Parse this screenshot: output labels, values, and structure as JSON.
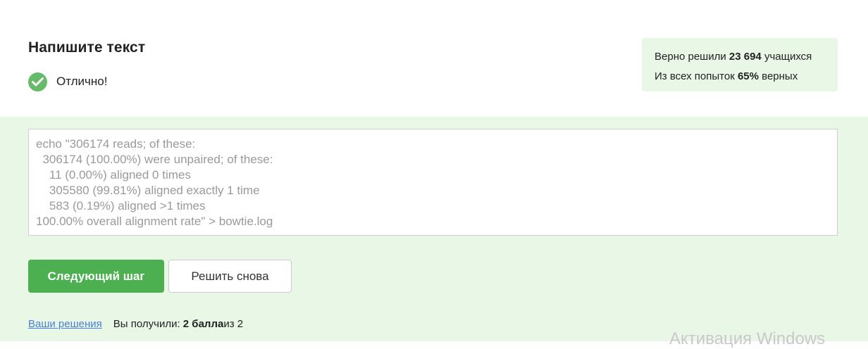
{
  "task": {
    "title": "Напишите текст",
    "status": "Отлично!"
  },
  "stats": {
    "line1_prefix": "Верно решили ",
    "solved_count": "23 694",
    "line1_suffix": " учащихся",
    "line2_prefix": "Из всех попыток ",
    "correct_percent": "65%",
    "line2_suffix": " верных"
  },
  "answer": {
    "text": "echo \"306174 reads; of these:\n  306174 (100.00%) were unpaired; of these:\n    11 (0.00%) aligned 0 times\n    305580 (99.81%) aligned exactly 1 time\n    583 (0.19%) aligned >1 times\n100.00% overall alignment rate\" > bowtie.log"
  },
  "buttons": {
    "next": "Следующий шаг",
    "retry": "Решить снова"
  },
  "footer": {
    "solutions_link": "Ваши решения",
    "score_prefix": "Вы получили: ",
    "score_value": "2 балла",
    "score_suffix": " из 2"
  },
  "watermark": "Активация Windows",
  "colors": {
    "accent_green": "#4caf50",
    "check_green": "#66bb6a",
    "panel_bg": "#e9f7e6",
    "link": "#4a7fd6"
  }
}
